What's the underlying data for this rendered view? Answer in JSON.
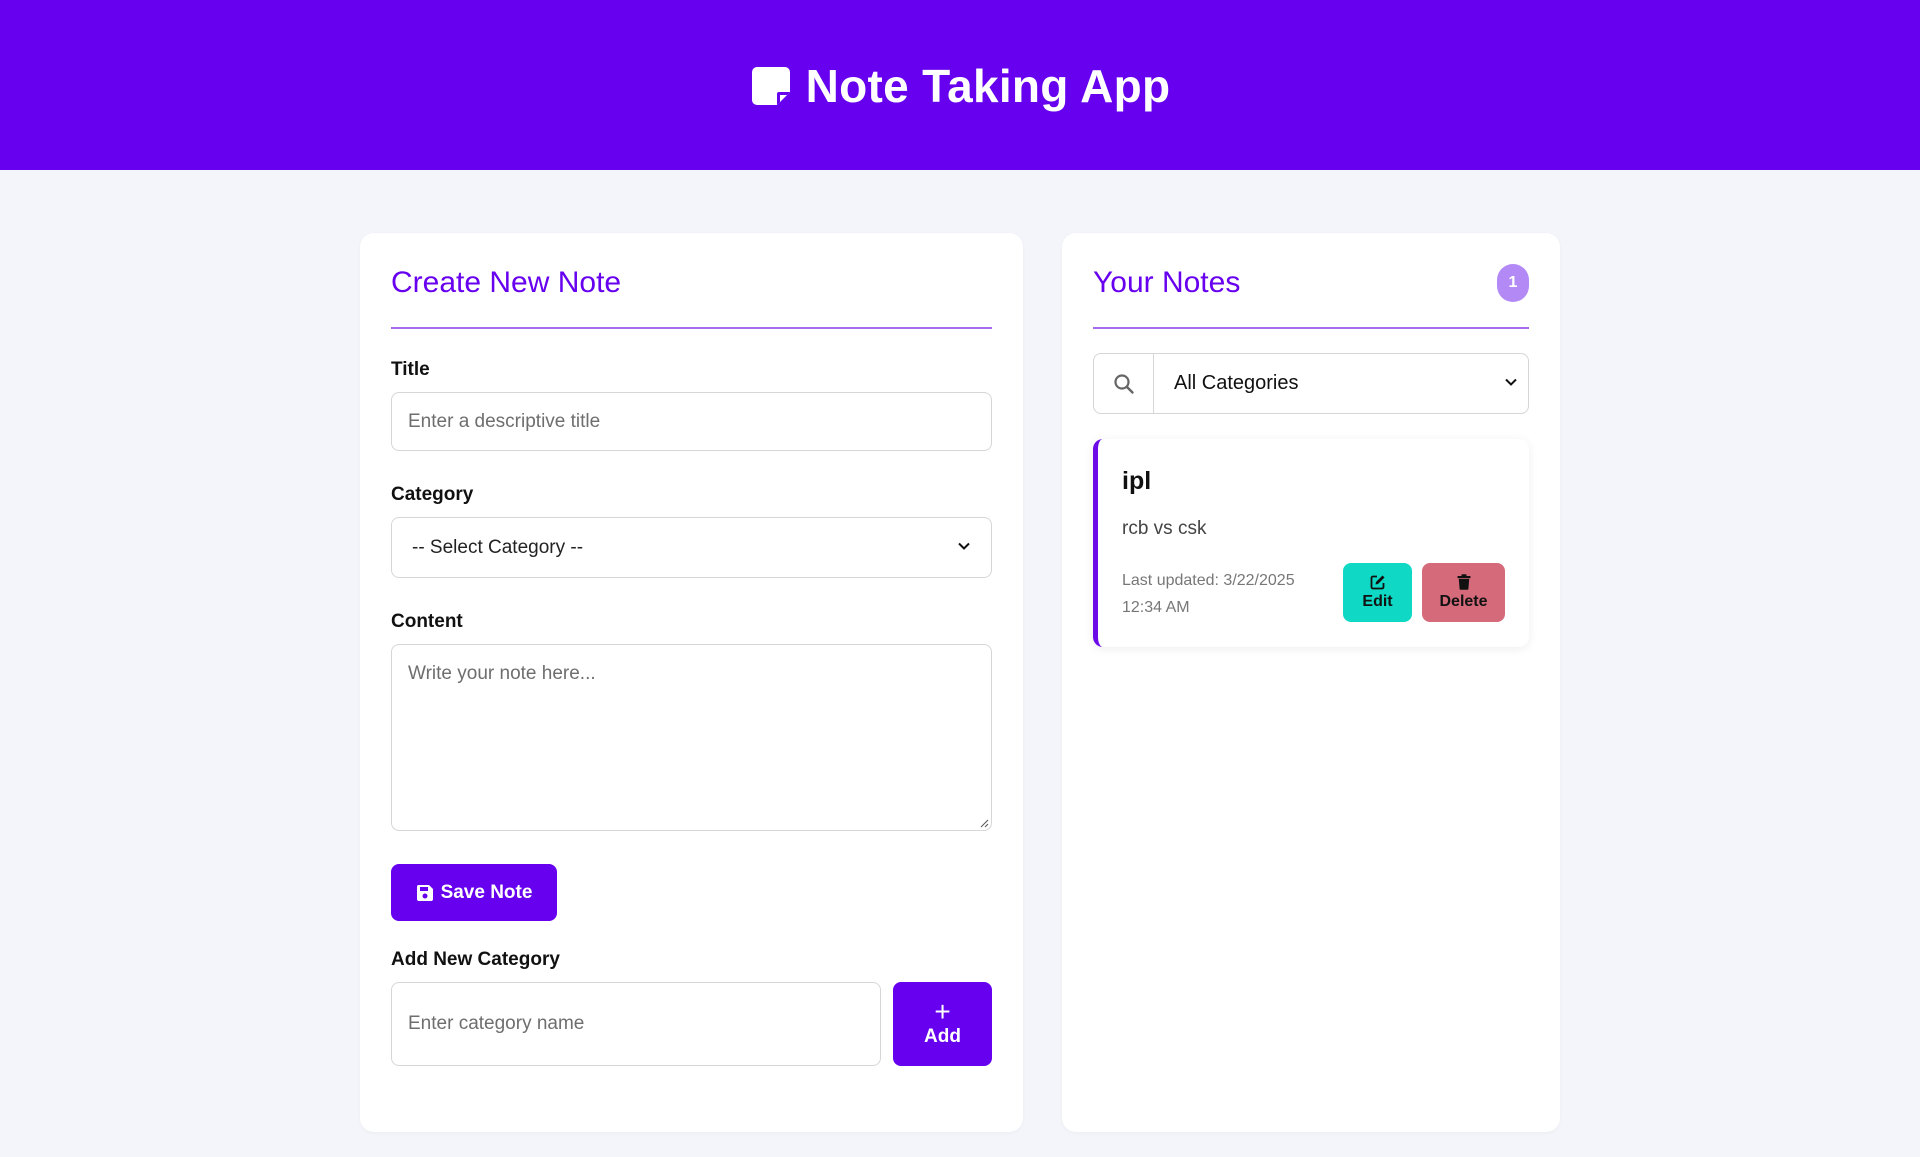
{
  "header": {
    "title": "Note Taking App",
    "icon": "sticky-note-icon",
    "background": "#6600ee"
  },
  "create_form": {
    "heading": "Create New Note",
    "title_label": "Title",
    "title_placeholder": "Enter a descriptive title",
    "category_label": "Category",
    "category_selected": "-- Select Category --",
    "content_label": "Content",
    "content_placeholder": "Write your note here...",
    "save_label": "Save Note",
    "new_category_label": "Add New Category",
    "new_category_placeholder": "Enter category name",
    "add_symbol": "+",
    "add_label": "Add"
  },
  "notes_panel": {
    "heading": "Your Notes",
    "count": "1",
    "filter_selected": "All Categories",
    "notes": [
      {
        "title": "ipl",
        "content": "rcb vs csk",
        "updated_line1": "Last updated: 3/22/2025",
        "updated_line2": "12:34 AM",
        "edit_label": "Edit",
        "delete_label": "Delete"
      }
    ]
  },
  "colors": {
    "accent": "#6600ee",
    "edit": "#0fd9c4",
    "delete": "#d56a7a",
    "badge": "#b38af5"
  }
}
